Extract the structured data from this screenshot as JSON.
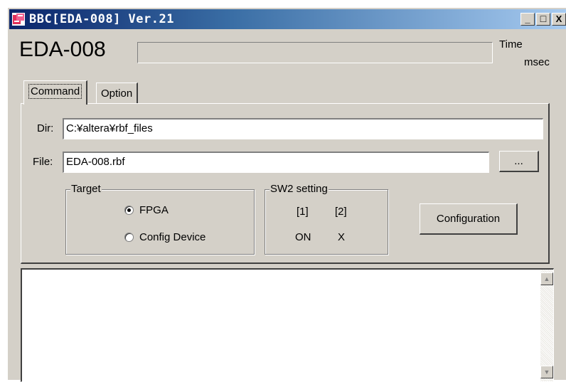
{
  "window": {
    "title": "BBC[EDA-008] Ver.21",
    "minimize": "_",
    "maximize": "□",
    "close": "X"
  },
  "header": {
    "app_name": "EDA-008",
    "progress_fraction": 0,
    "time_label": "Time",
    "time_unit": "msec"
  },
  "tabs": [
    {
      "label": "Command",
      "active": true
    },
    {
      "label": "Option",
      "active": false
    }
  ],
  "command": {
    "dir_label": "Dir:",
    "dir_value": "C:¥altera¥rbf_files",
    "file_label": "File:",
    "file_value": "EDA-008.rbf",
    "browse_label": "...",
    "target": {
      "title": "Target",
      "options": [
        {
          "label": "FPGA",
          "selected": true
        },
        {
          "label": "Config Device",
          "selected": false
        }
      ]
    },
    "sw2": {
      "title": "SW2 setting",
      "col1_header": "[1]",
      "col2_header": "[2]",
      "col1_value": "ON",
      "col2_value": "X"
    },
    "configuration_label": "Configuration"
  },
  "log": {
    "content": ""
  },
  "icons": {
    "app": "app-icon",
    "scroll_up": "scroll-up-arrow-icon",
    "scroll_down": "scroll-down-arrow-icon"
  },
  "colors": {
    "titlebar_start": "#0a246a",
    "titlebar_end": "#a6caf0",
    "face": "#d4d0c8"
  }
}
